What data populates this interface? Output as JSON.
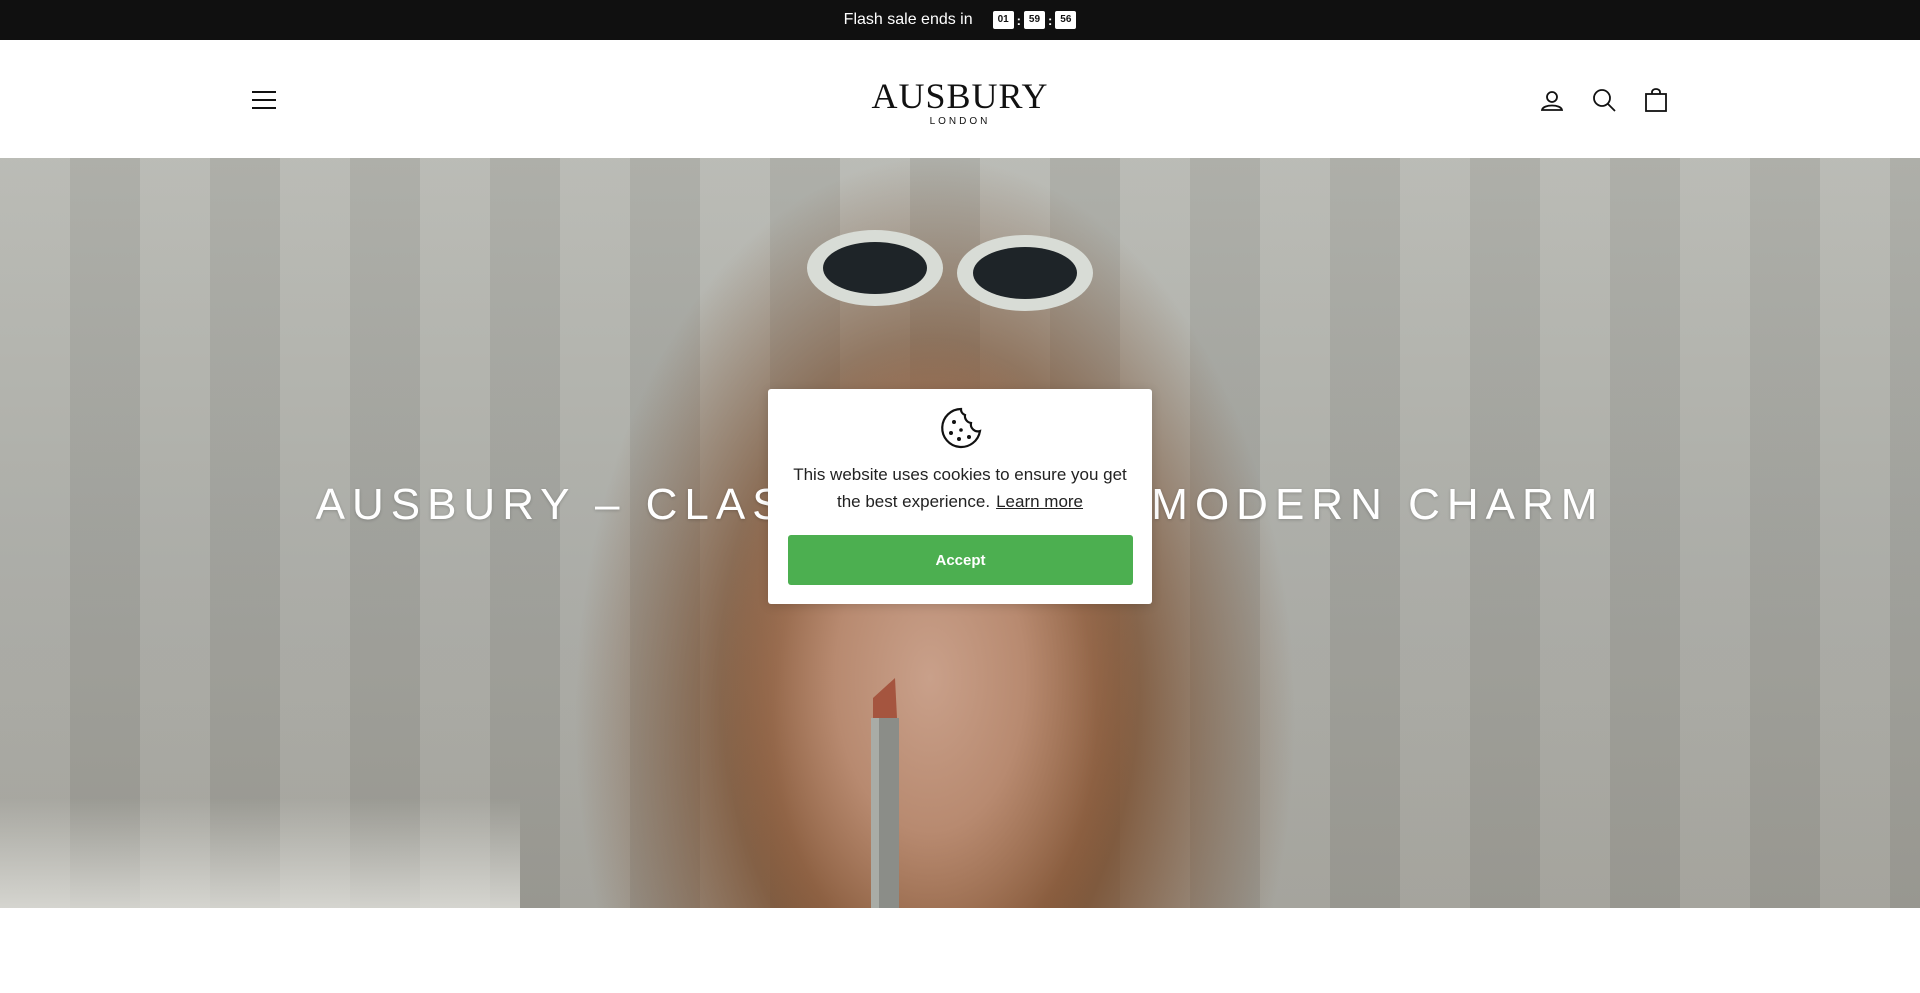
{
  "announcement": {
    "text": "Flash sale ends in",
    "timer": {
      "hours": "01",
      "minutes": "59",
      "seconds": "56"
    },
    "separator": ":"
  },
  "header": {
    "logo": {
      "name": "AUSBURY",
      "subtitle": "LONDON"
    },
    "icons": {
      "menu": "hamburger-menu-icon",
      "account": "user-icon",
      "search": "search-icon",
      "cart": "shopping-bag-icon"
    }
  },
  "hero": {
    "title": "AUSBURY – CLASSIC DESIGN, MODERN CHARM"
  },
  "cookie_banner": {
    "icon": "cookie-icon",
    "message": "This website uses cookies to ensure you get the best experience.",
    "learn_more": "Learn more",
    "accept_label": "Accept",
    "accent_color": "#4caf50"
  },
  "colors": {
    "announcement_bg": "#101010",
    "header_bg": "#ffffff",
    "accept_button": "#4caf50"
  }
}
